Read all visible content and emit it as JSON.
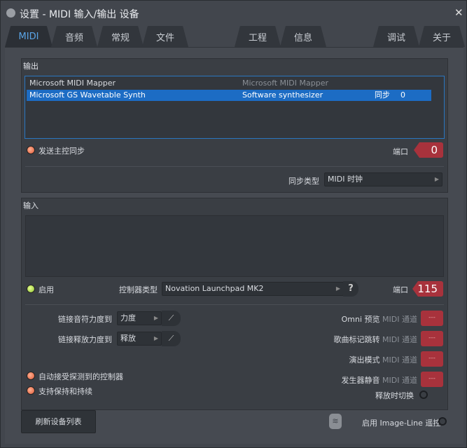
{
  "title": "设置 - MIDI 输入/输出 设备",
  "tabs": [
    "MIDI",
    "音频",
    "常规",
    "文件",
    "工程",
    "信息",
    "调试",
    "关于"
  ],
  "output": {
    "header": "输出",
    "devices": [
      {
        "name": "Microsoft MIDI Mapper",
        "desc": "Microsoft MIDI Mapper",
        "sync": "",
        "port": ""
      },
      {
        "name": "Microsoft GS Wavetable Synth",
        "desc": "Software synthesizer",
        "sync": "同步",
        "port": "0"
      }
    ],
    "send_sync_label": "发送主控同步",
    "port_label": "端口",
    "port_value": "0",
    "sync_type_label": "同步类型",
    "sync_type_value": "MIDI 时钟"
  },
  "input": {
    "header": "输入",
    "enable_label": "启用",
    "controller_type_label": "控制器类型",
    "controller_type_value": "Novation Launchpad MK2",
    "help": "?",
    "port_label": "端口",
    "port_value": "115",
    "link_velocity_label": "链接音符力度到",
    "link_velocity_value": "力度",
    "link_release_label": "链接释放力度到",
    "link_release_value": "释放",
    "channels": [
      {
        "label": "Omni 预览",
        "suffix": "MIDI 通道"
      },
      {
        "label": "歌曲标记跳转",
        "suffix": "MIDI 通道"
      },
      {
        "label": "演出模式",
        "suffix": "MIDI 通道"
      },
      {
        "label": "发生器静音",
        "suffix": "MIDI 通道"
      }
    ],
    "channel_value": "---",
    "toggle_on_release": "释放时切换",
    "auto_accept": "自动接受探测到的控制器",
    "sustain": "支持保持和持续"
  },
  "refresh_button": "刷新设备列表",
  "remote_label": "启用 Image-Line 遥控"
}
